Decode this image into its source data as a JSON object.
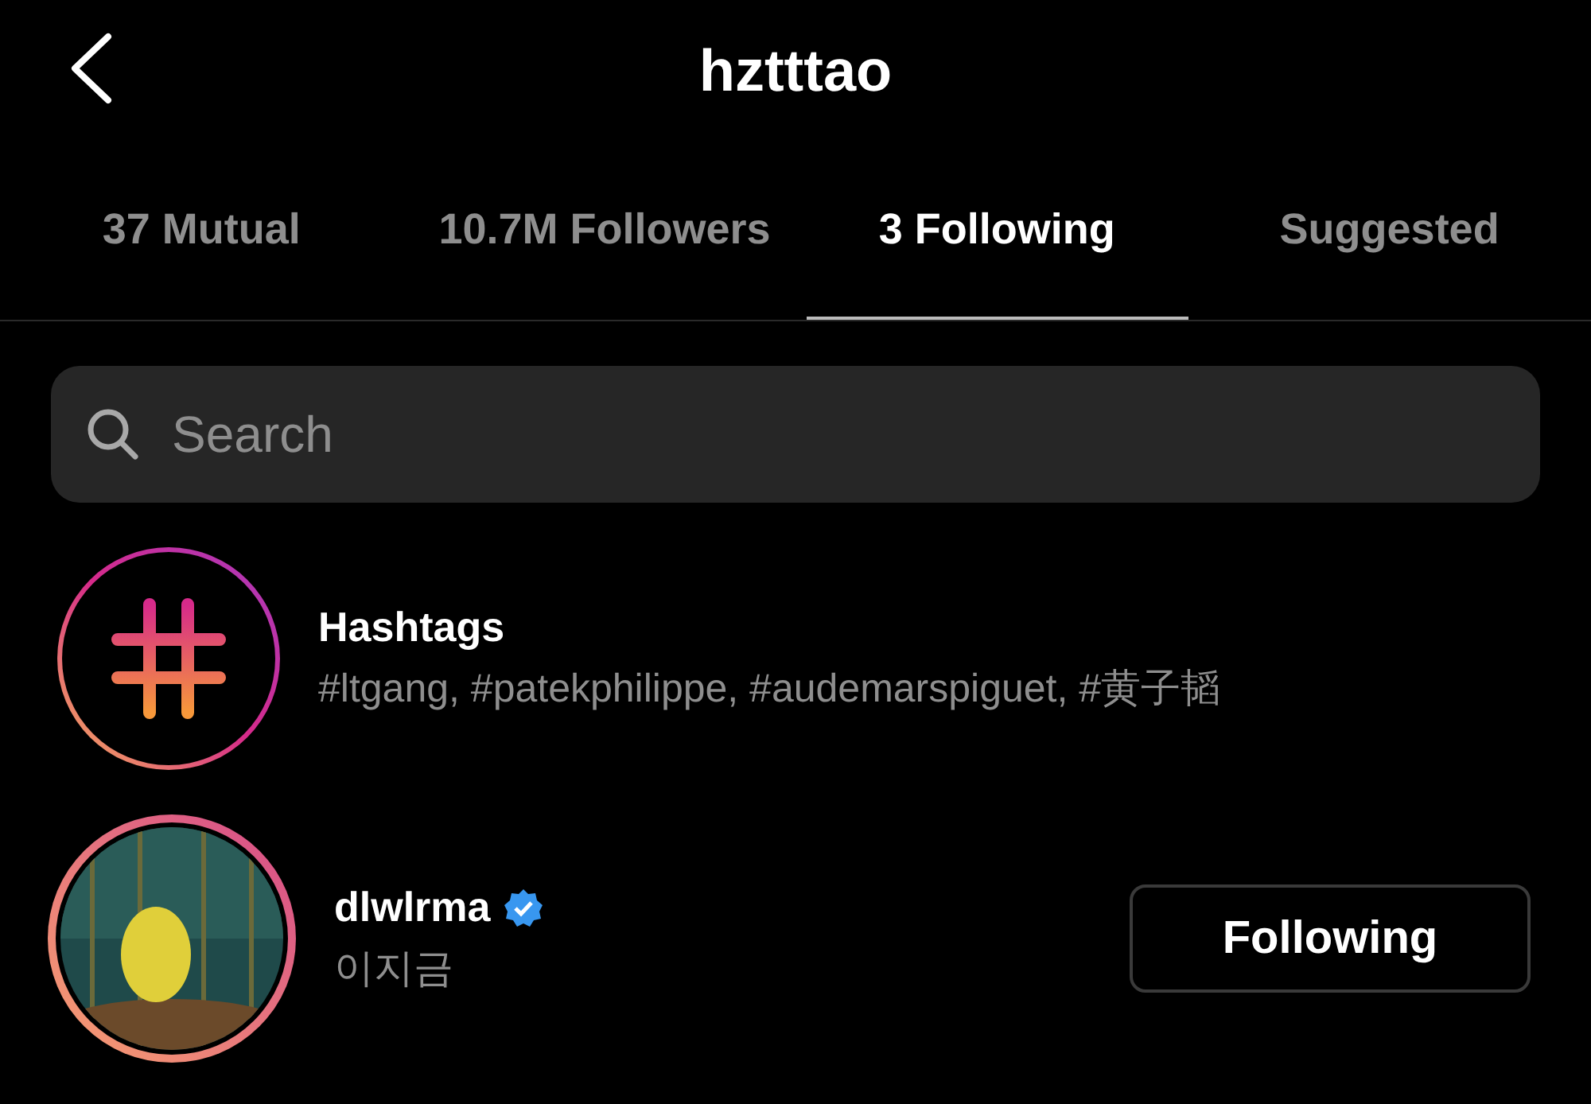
{
  "header": {
    "title": "hztttao"
  },
  "tabs": [
    {
      "label": "37 Mutual",
      "selected": false
    },
    {
      "label": "10.7M Followers",
      "selected": false
    },
    {
      "label": "3 Following",
      "selected": true
    },
    {
      "label": "Suggested",
      "selected": false
    }
  ],
  "search": {
    "placeholder": "Search"
  },
  "list": [
    {
      "kind": "hashtags",
      "title": "Hashtags",
      "subtitle": "#ltgang, #patekphilippe, #audemarspiguet, #黄子韬"
    },
    {
      "kind": "account",
      "title": "dlwlrma",
      "verified": true,
      "subtitle": "이지금",
      "button": "Following"
    }
  ]
}
